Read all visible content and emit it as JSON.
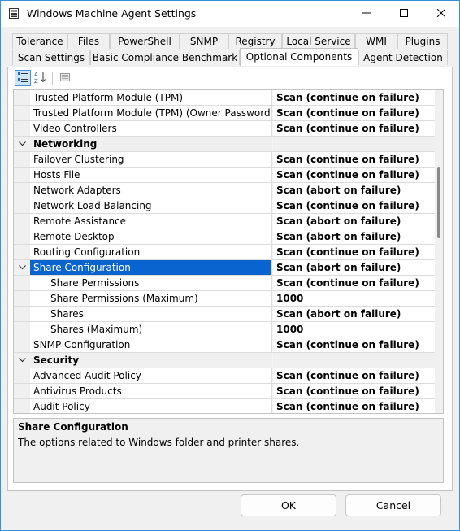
{
  "window": {
    "title": "Windows Machine Agent Settings"
  },
  "tabs_row1": [
    "Tolerance",
    "Files",
    "PowerShell",
    "SNMP",
    "Registry",
    "Local Service",
    "WMI",
    "Plugins"
  ],
  "tabs_row2": [
    "Scan Settings",
    "Basic Compliance Benchmark",
    "Optional Components",
    "Agent Detection"
  ],
  "active_tab": "Optional Components",
  "grid": {
    "rows": [
      {
        "type": "item",
        "level": 1,
        "name": "Trusted Platform Module (TPM)",
        "value": "Scan (continue on failure)"
      },
      {
        "type": "item",
        "level": 1,
        "name": "Trusted Platform Module (TPM) (Owner Password)",
        "value": "Scan (continue on failure)"
      },
      {
        "type": "item",
        "level": 1,
        "name": "Video Controllers",
        "value": "Scan (continue on failure)"
      },
      {
        "type": "category",
        "level": 0,
        "name": "Networking",
        "value": ""
      },
      {
        "type": "item",
        "level": 1,
        "name": "Failover Clustering",
        "value": "Scan (continue on failure)"
      },
      {
        "type": "item",
        "level": 1,
        "name": "Hosts File",
        "value": "Scan (continue on failure)"
      },
      {
        "type": "item",
        "level": 1,
        "name": "Network Adapters",
        "value": "Scan (abort on failure)"
      },
      {
        "type": "item",
        "level": 1,
        "name": "Network Load Balancing",
        "value": "Scan (continue on failure)"
      },
      {
        "type": "item",
        "level": 1,
        "name": "Remote Assistance",
        "value": "Scan (abort on failure)"
      },
      {
        "type": "item",
        "level": 1,
        "name": "Remote Desktop",
        "value": "Scan (abort on failure)"
      },
      {
        "type": "item",
        "level": 1,
        "name": "Routing Configuration",
        "value": "Scan (continue on failure)"
      },
      {
        "type": "item",
        "level": 1,
        "name": "Share Configuration",
        "value": "Scan (abort on failure)",
        "expanded": true,
        "selected": true
      },
      {
        "type": "item",
        "level": 2,
        "name": "Share Permissions",
        "value": "Scan (continue on failure)"
      },
      {
        "type": "item",
        "level": 2,
        "name": "Share Permissions (Maximum)",
        "value": "1000"
      },
      {
        "type": "item",
        "level": 2,
        "name": "Shares",
        "value": "Scan (abort on failure)"
      },
      {
        "type": "item",
        "level": 2,
        "name": "Shares (Maximum)",
        "value": "1000"
      },
      {
        "type": "item",
        "level": 1,
        "name": "SNMP Configuration",
        "value": "Scan (continue on failure)"
      },
      {
        "type": "category",
        "level": 0,
        "name": "Security",
        "value": ""
      },
      {
        "type": "item",
        "level": 1,
        "name": "Advanced Audit Policy",
        "value": "Scan (continue on failure)"
      },
      {
        "type": "item",
        "level": 1,
        "name": "Antivirus Products",
        "value": "Scan (continue on failure)"
      },
      {
        "type": "item",
        "level": 1,
        "name": "Audit Policy",
        "value": "Scan (continue on failure)"
      }
    ]
  },
  "description": {
    "title": "Share Configuration",
    "text": "The options related to Windows folder and printer shares."
  },
  "buttons": {
    "ok": "OK",
    "cancel": "Cancel"
  },
  "colors": {
    "selection": "#0a64d0",
    "window_border": "#3a8fd6"
  }
}
